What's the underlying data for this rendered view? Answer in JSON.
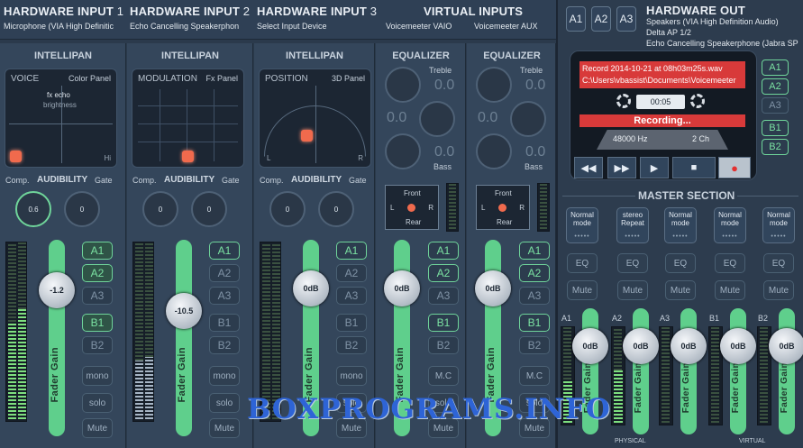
{
  "header": {
    "inputs": [
      {
        "title": "HARDWARE INPUT",
        "num": "1",
        "device": "Microphone (VIA High Definitic"
      },
      {
        "title": "HARDWARE INPUT",
        "num": "2",
        "device": "Echo Cancelling Speakerphon"
      },
      {
        "title": "HARDWARE INPUT",
        "num": "3",
        "device": "Select Input Device"
      }
    ],
    "virtual": {
      "title": "VIRTUAL INPUTS",
      "devices": [
        "Voicemeeter VAIO",
        "Voicemeeter AUX"
      ]
    },
    "out_buttons": [
      "A1",
      "A2",
      "A3"
    ],
    "hardware_out": {
      "title": "HARDWARE OUT",
      "devices": [
        "Speakers (VIA High Definition Audio)",
        "Delta AP 1/2",
        "Echo Cancelling Speakerphone (Jabra SP"
      ]
    }
  },
  "strips": [
    {
      "title": "INTELLIPAN",
      "panel_left": "VOICE",
      "panel_right": "Color Panel",
      "sub1": "fx echo",
      "sub2": "brightness",
      "corner": "Hi",
      "comp": "Comp.",
      "aud": "AUDIBILITY",
      "gate": "Gate",
      "comp_val": "0.6",
      "gate_val": "0",
      "fader": "-1.2",
      "fader_label": "Fader Gain",
      "buses": [
        "A1",
        "A2",
        "A3",
        "B1",
        "B2"
      ],
      "modes": [
        "mono",
        "solo",
        "Mute"
      ]
    },
    {
      "title": "INTELLIPAN",
      "panel_left": "MODULATION",
      "panel_right": "Fx Panel",
      "comp": "Comp.",
      "aud": "AUDIBILITY",
      "gate": "Gate",
      "comp_val": "0",
      "gate_val": "0",
      "fader": "-10.5",
      "fader_label": "Fader Gain",
      "buses": [
        "A1",
        "A2",
        "A3",
        "B1",
        "B2"
      ],
      "modes": [
        "mono",
        "solo",
        "Mute"
      ]
    },
    {
      "title": "INTELLIPAN",
      "panel_left": "POSITION",
      "panel_right": "3D Panel",
      "corner_l": "L",
      "corner_r": "R",
      "comp": "Comp.",
      "aud": "AUDIBILITY",
      "gate": "Gate",
      "comp_val": "0",
      "gate_val": "0",
      "fader": "0dB",
      "fader_label": "Fader Gain",
      "buses": [
        "A1",
        "A2",
        "A3",
        "B1",
        "B2"
      ],
      "modes": [
        "mono",
        "solo",
        "Mute"
      ]
    }
  ],
  "virtual_strips": [
    {
      "title": "EQUALIZER",
      "treble": "Treble",
      "treble_val": "0.0",
      "mid_val": "0.0",
      "bass_val": "0.0",
      "bass": "Bass",
      "front": "Front",
      "rear": "Rear",
      "l": "L",
      "r": "R",
      "fader": "0dB",
      "fader_label": "Fader Gain",
      "buses": [
        "A1",
        "A2",
        "A3",
        "B1",
        "B2"
      ],
      "modes": [
        "M.C",
        "solo",
        "Mute"
      ]
    },
    {
      "title": "EQUALIZER",
      "treble": "Treble",
      "treble_val": "0.0",
      "mid_val": "0.0",
      "bass_val": "0.0",
      "bass": "Bass",
      "front": "Front",
      "rear": "Rear",
      "l": "L",
      "r": "R",
      "fader": "0dB",
      "fader_label": "Fader Gain",
      "buses": [
        "A1",
        "A2",
        "A3",
        "B1",
        "B2"
      ],
      "modes": [
        "M.C",
        "solo",
        "Mute"
      ]
    }
  ],
  "recorder": {
    "line1": "Record 2014-10-21 at 08h03m25s.wav",
    "line2": "C:\\Users\\vbassist\\Documents\\Voicemeeter",
    "time": "00:05",
    "status": "Recording...",
    "rate": "48000 Hz",
    "channels": "2 Ch",
    "transport": [
      "◀◀",
      "▶▶",
      "▶",
      "■",
      "●"
    ],
    "side_buses": [
      "A1",
      "A2",
      "A3",
      "B1",
      "B2"
    ]
  },
  "master": {
    "title": "MASTER SECTION",
    "modes": [
      [
        "Normal",
        "mode"
      ],
      [
        "stereo",
        "Repeat"
      ],
      [
        "Normal",
        "mode"
      ],
      [
        "Normal",
        "mode"
      ],
      [
        "Normal",
        "mode"
      ]
    ],
    "eq": "EQ",
    "mute": "Mute",
    "channels": [
      "A1",
      "A2",
      "A3",
      "B1",
      "B2"
    ],
    "fader": "0dB",
    "fader_label": "Fader Gain",
    "footer_left": "PHYSICAL",
    "footer_right": "VIRTUAL"
  },
  "watermark": "BOXPROGRAMS.INFO"
}
